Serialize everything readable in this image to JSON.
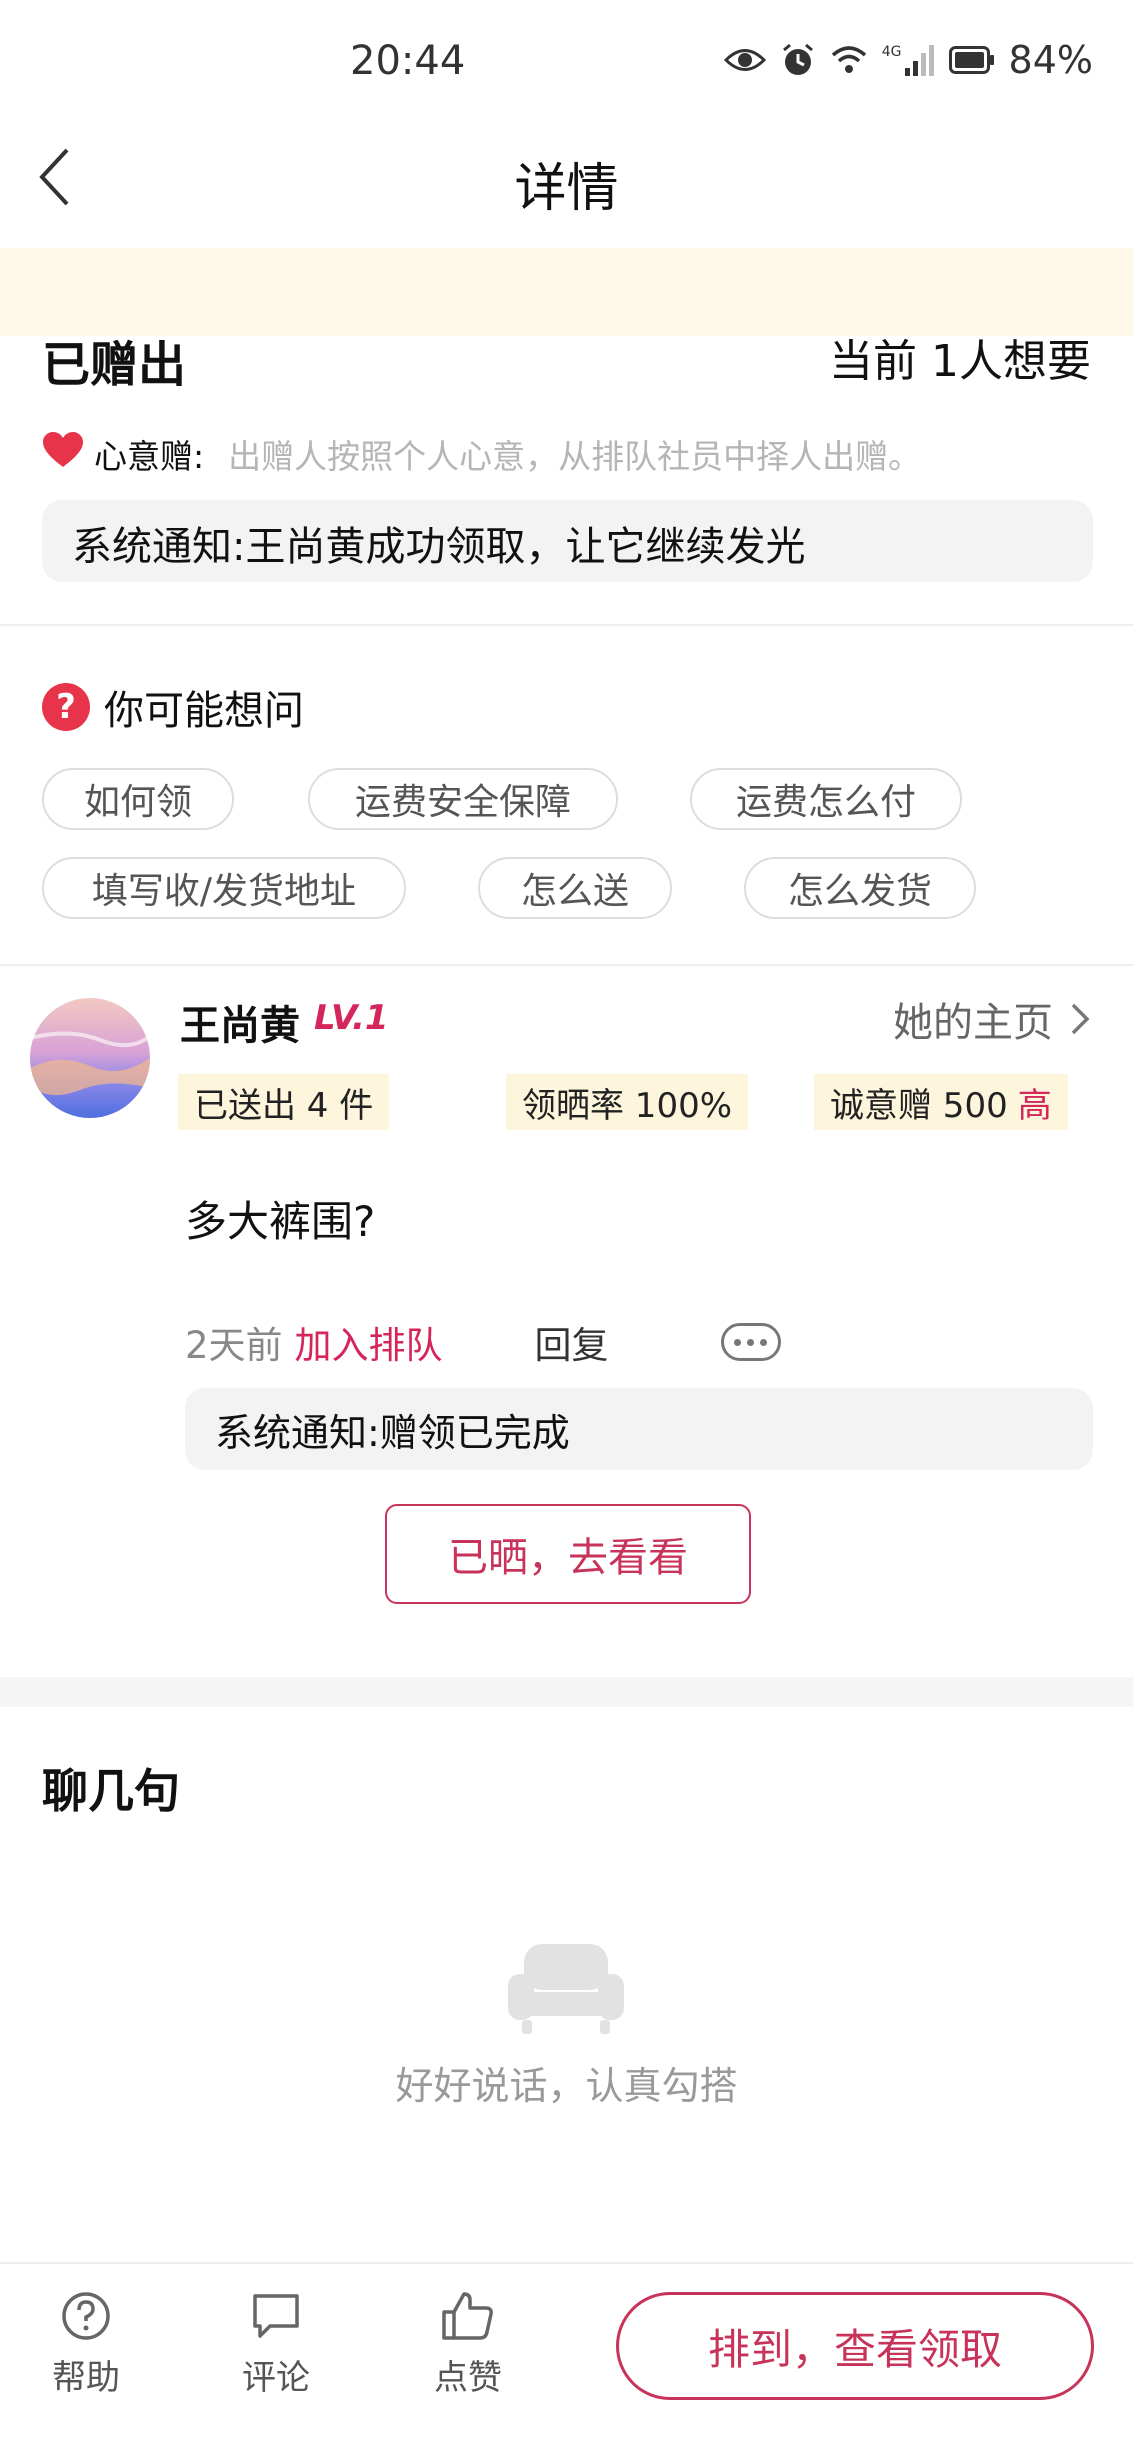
{
  "status_bar": {
    "time": "20:44",
    "network": "4G",
    "battery": "84%",
    "icons": [
      "eye-icon",
      "alarm-icon",
      "wifi-icon",
      "signal-icon",
      "battery-icon"
    ]
  },
  "nav": {
    "title": "详情",
    "back_icon": "chevron-left-icon"
  },
  "gift": {
    "status": "已赠出",
    "want_count": "当前 1人想要",
    "mode_label": "心意赠:",
    "mode_desc": "出赠人按照个人心意，从排队社员中择人出赠。",
    "system_notice": "系统通知:王尚黄成功领取，让它继续发光"
  },
  "faq": {
    "title": "你可能想问",
    "chips": [
      "如何领",
      "运费安全保障",
      "运费怎么付",
      "填写收/发货地址",
      "怎么送",
      "怎么发货"
    ]
  },
  "user": {
    "name": "王尚黄",
    "level": "LV.1",
    "homepage_link": "她的主页",
    "stats": {
      "sent": "已送出 4 件",
      "share_rate": "领晒率 100%",
      "sincerity": "诚意赠 500",
      "sincerity_level": "高"
    }
  },
  "comment": {
    "text": "多大裤围?",
    "time": "2天前",
    "join_queue": "加入排队",
    "reply": "回复",
    "system_notice": "系统通知:赠领已完成",
    "shared_button": "已晒，去看看"
  },
  "chat": {
    "title": "聊几句",
    "empty_text": "好好说话，认真勾搭"
  },
  "bottom_bar": {
    "help": "帮助",
    "comment": "评论",
    "like": "点赞",
    "cta": "排到，查看领取"
  },
  "colors": {
    "accent": "#d4265a",
    "notice_band": "#fdf9e6",
    "stat_bg": "#fdf5dc",
    "heart": "#e8344b"
  }
}
